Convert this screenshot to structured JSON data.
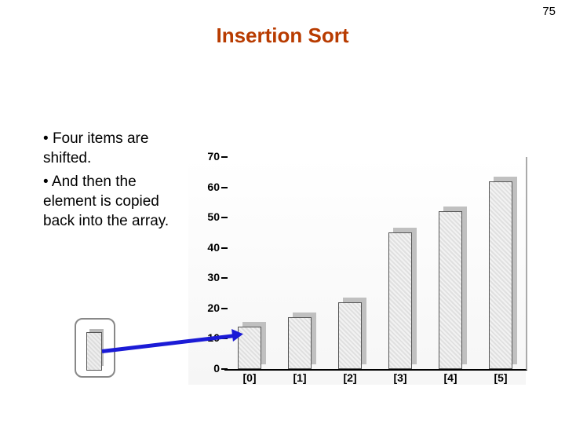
{
  "page_number": "75",
  "title": "Insertion Sort",
  "bullets": [
    "Four items are shifted.",
    "And then the element is copied back into the array."
  ],
  "chart_data": {
    "type": "bar",
    "categories": [
      "[0]",
      "[1]",
      "[2]",
      "[3]",
      "[4]",
      "[5]"
    ],
    "values": [
      14,
      17,
      22,
      45,
      52,
      62
    ],
    "floating_value": 14,
    "y_ticks": [
      0,
      10,
      20,
      30,
      40,
      50,
      60,
      70
    ],
    "ylim": [
      0,
      70
    ],
    "title": "",
    "xlabel": "",
    "ylabel": ""
  }
}
